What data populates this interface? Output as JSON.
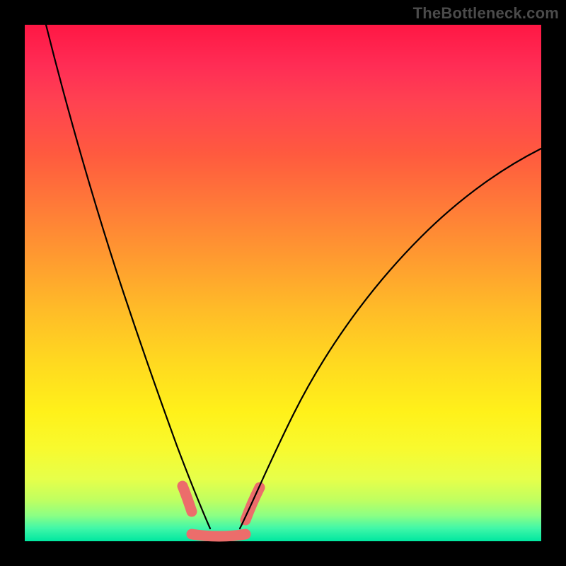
{
  "watermark": "TheBottleneck.com",
  "colors": {
    "frame": "#000000",
    "watermark": "#4b4b4b",
    "curve": "#000000",
    "highlight": "#ec6d6b",
    "gradient_top": "#ff1744",
    "gradient_bottom": "#00e7a0"
  },
  "chart_data": {
    "type": "line",
    "title": "",
    "xlabel": "",
    "ylabel": "",
    "xlim": [
      0,
      100
    ],
    "ylim": [
      0,
      100
    ],
    "note": "No axis ticks or labels are visible; values are normalized 0–100 estimates read from pixel positions (y=0 bottom, y=100 top).",
    "series": [
      {
        "name": "left-curve",
        "x": [
          4,
          8,
          12,
          16,
          20,
          23,
          26,
          28.5,
          30,
          31.5,
          33,
          34.5,
          36
        ],
        "y": [
          100,
          82,
          66,
          52,
          40,
          30,
          22,
          16,
          12,
          8.5,
          6,
          4,
          2.5
        ]
      },
      {
        "name": "right-curve",
        "x": [
          42,
          44,
          46,
          49,
          53,
          58,
          64,
          72,
          82,
          92,
          100
        ],
        "y": [
          2.5,
          5,
          8,
          13,
          20,
          28,
          37,
          47,
          58,
          68,
          76
        ]
      },
      {
        "name": "bottom-flat-highlight",
        "x": [
          32,
          43
        ],
        "y": [
          1.5,
          1.5
        ]
      }
    ],
    "annotations": [
      {
        "name": "left-highlight-segment",
        "x": [
          30.5,
          32
        ],
        "y": [
          10.5,
          6
        ]
      },
      {
        "name": "right-highlight-segment",
        "x": [
          42.5,
          45
        ],
        "y": [
          4,
          10
        ]
      }
    ]
  }
}
